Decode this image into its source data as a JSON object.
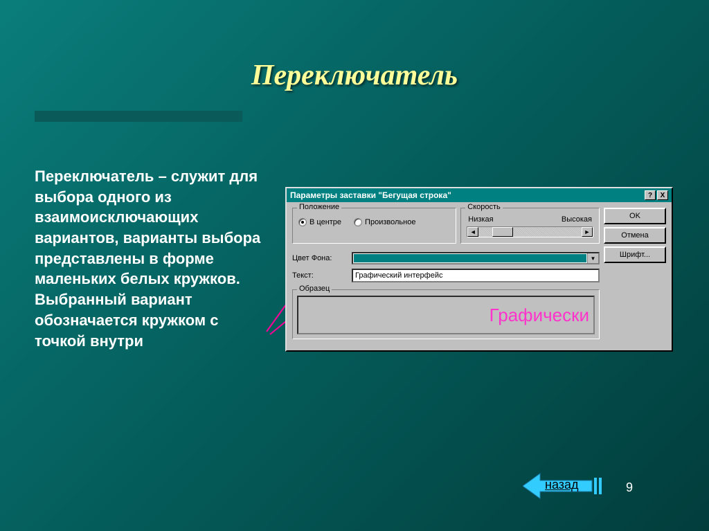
{
  "slide": {
    "title": "Переключатель",
    "body_term": "Переключатель",
    "body_rest": " – служит для выбора одного из взаимоисключающих вариантов, варианты выбора представлены в форме маленьких белых кружков. Выбранный вариант обозначается кружком с точкой внутри",
    "page_number": "9",
    "back_label": "назад"
  },
  "dialog": {
    "title": "Параметры заставки \"Бегущая строка\"",
    "help_btn": "?",
    "close_btn": "X",
    "groups": {
      "position": "Положение",
      "speed": "Скорость",
      "sample": "Образец"
    },
    "radios": {
      "center": "В центре",
      "random": "Произвольное"
    },
    "speed": {
      "low": "Низкая",
      "high": "Высокая"
    },
    "labels": {
      "bgcolor": "Цвет Фона:",
      "text": "Текст:"
    },
    "text_value": "Графический интерфейс",
    "sample_text": "Графически",
    "buttons": {
      "ok": "OK",
      "cancel": "Отмена",
      "font": "Шрифт..."
    }
  }
}
